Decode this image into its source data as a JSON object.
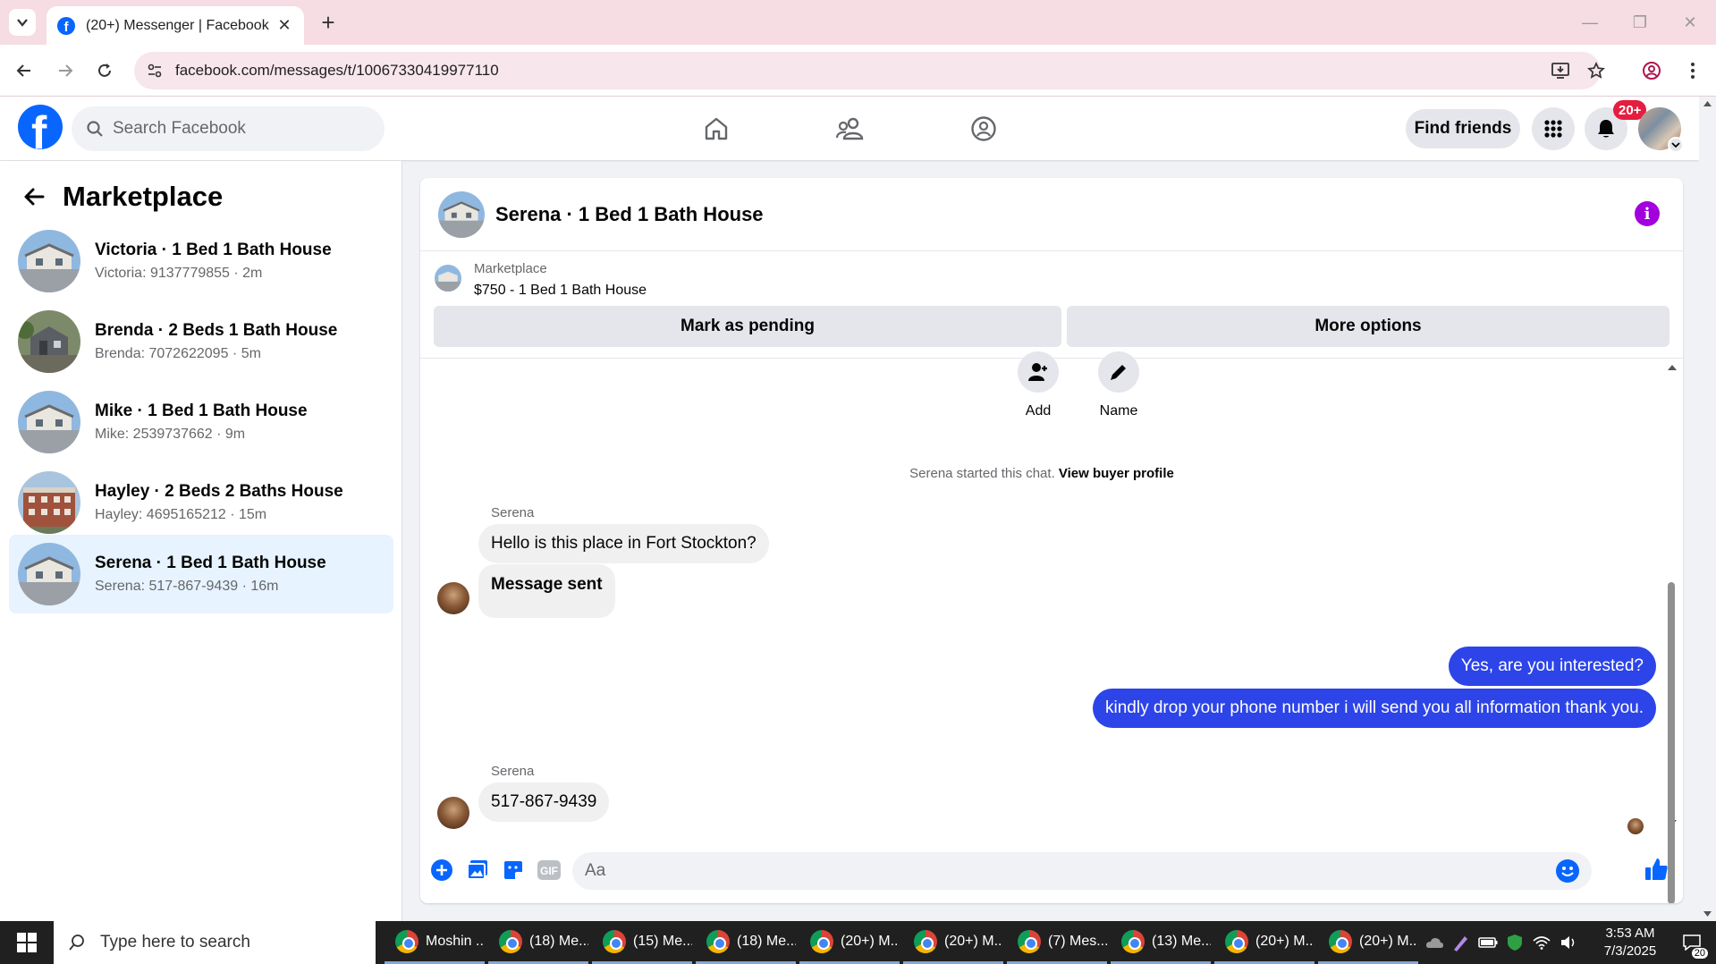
{
  "browser": {
    "tab_title": "(20+) Messenger | Facebook",
    "url": "facebook.com/messages/t/10067330419977110"
  },
  "fb": {
    "search_placeholder": "Search Facebook",
    "find_friends": "Find friends",
    "notif_badge": "20+",
    "brand_color": "#0866ff"
  },
  "sidebar": {
    "title": "Marketplace",
    "conversations": [
      {
        "name": "Victoria · 1 Bed 1 Bath House",
        "sub": "Victoria: 9137779855 · 2m"
      },
      {
        "name": "Brenda · 2 Beds 1 Bath House",
        "sub": "Brenda: 7072622095 · 5m"
      },
      {
        "name": "Mike · 1 Bed 1 Bath House",
        "sub": "Mike: 2539737662 · 9m"
      },
      {
        "name": "Hayley · 2 Beds 2 Baths House",
        "sub": "Hayley: 4695165212 · 15m"
      },
      {
        "name": "Serena · 1 Bed 1 Bath House",
        "sub": "Serena: 517-867-9439 · 16m"
      }
    ]
  },
  "chat": {
    "title": "Serena · 1 Bed 1 Bath House",
    "listing_label": "Marketplace",
    "listing_price": "$750 - 1 Bed 1 Bath House",
    "mark_pending": "Mark as pending",
    "more_options": "More options",
    "action_add": "Add",
    "action_name": "Name",
    "system_text": "Serena started this chat.",
    "view_profile": "View buyer profile",
    "sender1": "Serena",
    "msg1": "Hello is this place in Fort Stockton?",
    "msg2": "Message sent",
    "msg3": "Yes, are you interested?",
    "msg4": "kindly drop your phone number i will send you all information thank you.",
    "sender2": "Serena",
    "msg5": "517-867-9439",
    "composer_placeholder": "Aa",
    "outgoing_color": "#2c44e8"
  },
  "taskbar": {
    "search_placeholder": "Type here to search",
    "items": [
      "Moshin ...",
      "(18) Me...",
      "(15) Me...",
      "(18) Me...",
      "(20+) M...",
      "(20+) M...",
      "(7) Mes...",
      "(13) Me...",
      "(20+) M...",
      "(20+) M..."
    ],
    "time": "3:53 AM",
    "date": "7/3/2025",
    "notification_count": "20"
  }
}
